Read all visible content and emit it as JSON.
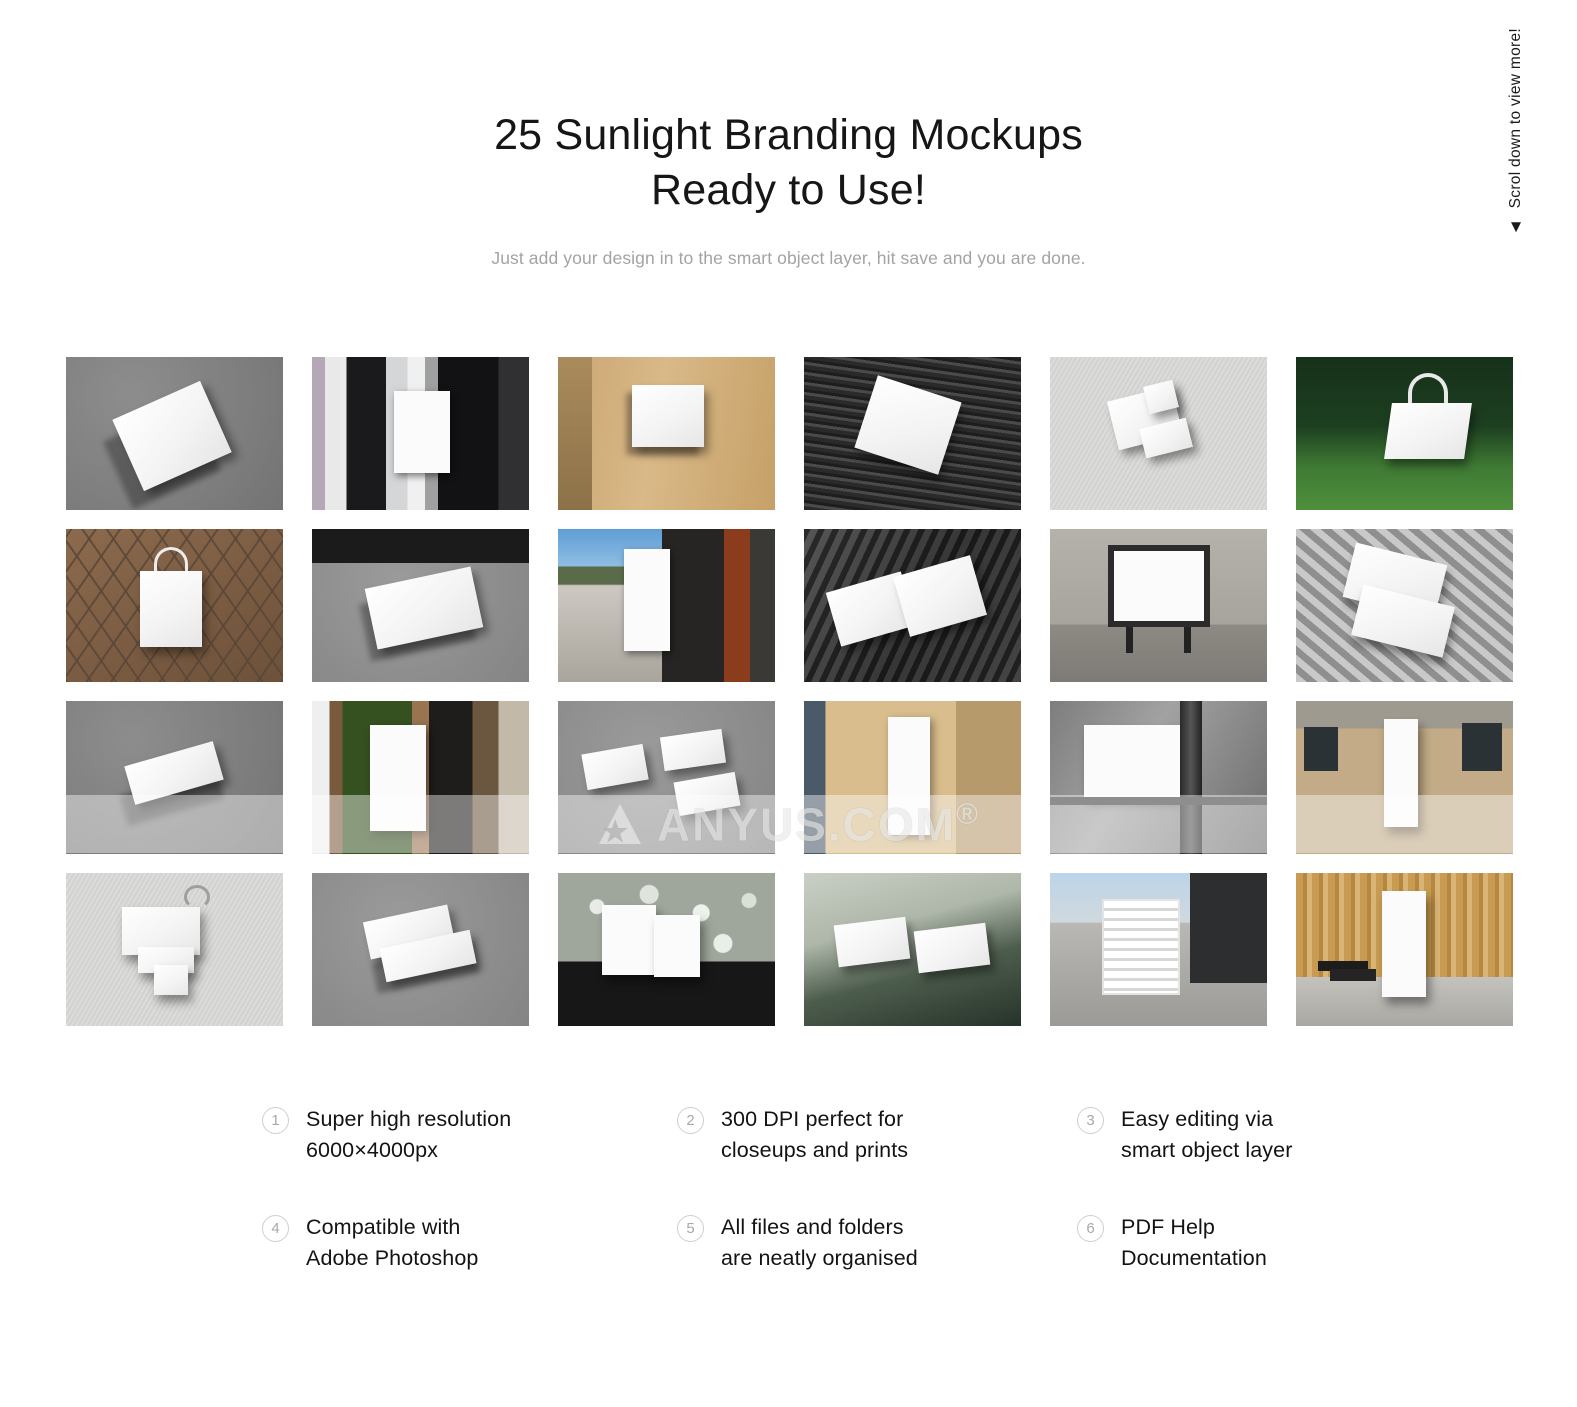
{
  "header": {
    "title_line1": "25 Sunlight Branding Mockups",
    "title_line2": "Ready to Use!",
    "subtitle": "Just add your design in to the smart object layer, hit save and you are done."
  },
  "scroll_hint": {
    "text": "Scrol down to view more!",
    "arrow": "▼",
    "icon": "chevron-down-icon"
  },
  "watermark": {
    "text": "ANYUS.COM",
    "registered": "®",
    "logo_icon": "star-logo-icon"
  },
  "gallery": {
    "columns": 6,
    "rows": 4,
    "tiles": [
      {
        "id": 1,
        "label": "book-cover-on-grey-concrete"
      },
      {
        "id": 2,
        "label": "poster-frame-on-glass-door"
      },
      {
        "id": 3,
        "label": "sign-on-sandstone-wall"
      },
      {
        "id": 4,
        "label": "paper-on-dark-metal-grate"
      },
      {
        "id": 5,
        "label": "folded-stationery-on-stucco"
      },
      {
        "id": 6,
        "label": "tote-bag-on-grass"
      },
      {
        "id": 7,
        "label": "tote-bag-on-rusty-mesh"
      },
      {
        "id": 8,
        "label": "poster-on-concrete-pavement"
      },
      {
        "id": 9,
        "label": "city-light-billboard-street"
      },
      {
        "id": 10,
        "label": "open-brochure-on-table"
      },
      {
        "id": 11,
        "label": "framed-sign-on-brick-wall"
      },
      {
        "id": 12,
        "label": "papers-with-striped-shadow"
      },
      {
        "id": 13,
        "label": "business-card-stack-concrete"
      },
      {
        "id": 14,
        "label": "standing-sign-by-plants"
      },
      {
        "id": 15,
        "label": "three-cards-on-grey-wall"
      },
      {
        "id": 16,
        "label": "banner-on-old-building"
      },
      {
        "id": 17,
        "label": "billboard-with-scaffold-pole"
      },
      {
        "id": 18,
        "label": "poster-on-brick-facade"
      },
      {
        "id": 19,
        "label": "hanger-and-papers-on-stucco"
      },
      {
        "id": 20,
        "label": "card-stack-on-grey-concrete"
      },
      {
        "id": 21,
        "label": "cards-on-white-pebbles"
      },
      {
        "id": 22,
        "label": "two-cards-on-green-glass"
      },
      {
        "id": 23,
        "label": "shipping-container-street"
      },
      {
        "id": 24,
        "label": "standing-panel-wood-wall"
      }
    ]
  },
  "features": [
    {
      "num": "1",
      "line1": "Super high resolution",
      "line2": "6000×4000px"
    },
    {
      "num": "2",
      "line1": "300 DPI perfect for",
      "line2": "closeups and prints"
    },
    {
      "num": "3",
      "line1": "Easy editing via",
      "line2": "smart object layer"
    },
    {
      "num": "4",
      "line1": "Compatible with",
      "line2": "Adobe Photoshop"
    },
    {
      "num": "5",
      "line1": "All files and folders",
      "line2": "are neatly organised"
    },
    {
      "num": "6",
      "line1": "PDF Help",
      "line2": "Documentation"
    }
  ],
  "colors": {
    "background": "#ffffff",
    "title": "#161616",
    "subtitle": "#a3a3a3",
    "feature_text": "#131313",
    "feature_num": "#a8a8a8",
    "feature_circle": "#cfcfcf"
  }
}
